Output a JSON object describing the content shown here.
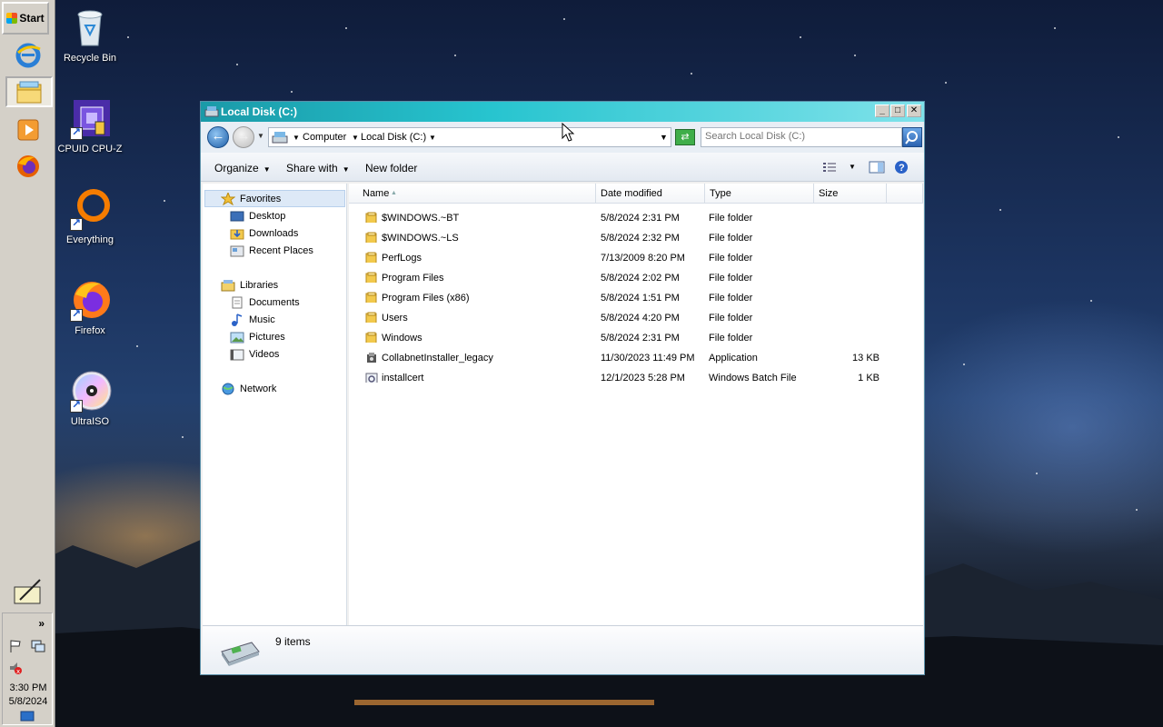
{
  "taskbar": {
    "start_label": "Start",
    "clock_time": "3:30 PM",
    "clock_date": "5/8/2024",
    "tray_expand": "»"
  },
  "desktop_icons": [
    {
      "label": "Recycle Bin",
      "icon": "recycle-bin-icon"
    },
    {
      "label": "CPUID CPU-Z",
      "icon": "cpuz-icon"
    },
    {
      "label": "Everything",
      "icon": "everything-icon"
    },
    {
      "label": "Firefox",
      "icon": "firefox-icon"
    },
    {
      "label": "UltraISO",
      "icon": "ultraiso-icon"
    }
  ],
  "window": {
    "title": "Local Disk (C:)",
    "min_label": "_",
    "max_label": "□",
    "close_label": "✕"
  },
  "address": {
    "crumbs": [
      "Computer",
      "Local Disk (C:)"
    ],
    "search_placeholder": "Search Local Disk (C:)"
  },
  "toolbar": {
    "organize": "Organize",
    "share_with": "Share with",
    "new_folder": "New folder"
  },
  "nav": {
    "favorites": "Favorites",
    "desktop": "Desktop",
    "downloads": "Downloads",
    "recent_places": "Recent Places",
    "libraries": "Libraries",
    "documents": "Documents",
    "music": "Music",
    "pictures": "Pictures",
    "videos": "Videos",
    "network": "Network"
  },
  "columns": {
    "name": "Name",
    "date_modified": "Date modified",
    "type": "Type",
    "size": "Size"
  },
  "files": [
    {
      "name": "$WINDOWS.~BT",
      "date": "5/8/2024 2:31 PM",
      "type": "File folder",
      "size": "",
      "kind": "folder"
    },
    {
      "name": "$WINDOWS.~LS",
      "date": "5/8/2024 2:32 PM",
      "type": "File folder",
      "size": "",
      "kind": "folder"
    },
    {
      "name": "PerfLogs",
      "date": "7/13/2009 8:20 PM",
      "type": "File folder",
      "size": "",
      "kind": "folder"
    },
    {
      "name": "Program Files",
      "date": "5/8/2024 2:02 PM",
      "type": "File folder",
      "size": "",
      "kind": "folder"
    },
    {
      "name": "Program Files (x86)",
      "date": "5/8/2024 1:51 PM",
      "type": "File folder",
      "size": "",
      "kind": "folder"
    },
    {
      "name": "Users",
      "date": "5/8/2024 4:20 PM",
      "type": "File folder",
      "size": "",
      "kind": "folder"
    },
    {
      "name": "Windows",
      "date": "5/8/2024 2:31 PM",
      "type": "File folder",
      "size": "",
      "kind": "folder"
    },
    {
      "name": "CollabnetInstaller_legacy",
      "date": "11/30/2023 11:49 PM",
      "type": "Application",
      "size": "13 KB",
      "kind": "app"
    },
    {
      "name": "installcert",
      "date": "12/1/2023 5:28 PM",
      "type": "Windows Batch File",
      "size": "1 KB",
      "kind": "batch"
    }
  ],
  "status": {
    "item_count": "9 items"
  }
}
